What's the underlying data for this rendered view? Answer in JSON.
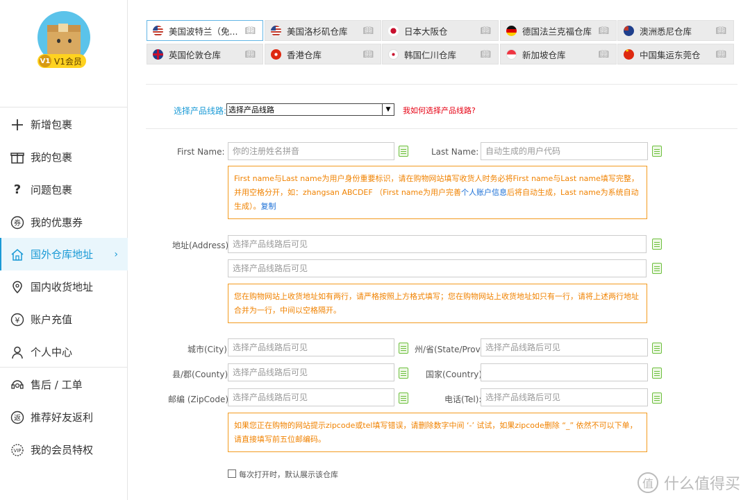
{
  "user": {
    "vip_level": "V1",
    "vip_label": "V1会员"
  },
  "sidebar": {
    "items": [
      {
        "label": "新增包裹",
        "icon": "plus-icon"
      },
      {
        "label": "我的包裹",
        "icon": "gift-box-icon"
      },
      {
        "label": "问题包裹",
        "icon": "question-icon"
      },
      {
        "label": "我的优惠券",
        "icon": "coupon-icon"
      },
      {
        "label": "国外仓库地址",
        "icon": "home-icon",
        "active": true
      },
      {
        "label": "国内收货地址",
        "icon": "location-pin-icon"
      },
      {
        "label": "账户充值",
        "icon": "yen-icon"
      },
      {
        "label": "个人中心",
        "icon": "user-icon"
      },
      {
        "label": "售后 / 工单",
        "icon": "headset-icon"
      },
      {
        "label": "推荐好友返利",
        "icon": "rebate-icon"
      },
      {
        "label": "我的会员特权",
        "icon": "vip-icon"
      }
    ],
    "active_chevron": "›"
  },
  "tabs": [
    {
      "label": "美国波特兰（免...",
      "flag": "us",
      "active": true
    },
    {
      "label": "美国洛杉矶仓库",
      "flag": "us"
    },
    {
      "label": "日本大阪仓",
      "flag": "jp"
    },
    {
      "label": "德国法兰克福仓库",
      "flag": "de"
    },
    {
      "label": "澳洲悉尼仓库",
      "flag": "au"
    },
    {
      "label": "英国伦敦仓库",
      "flag": "uk"
    },
    {
      "label": "香港仓库",
      "flag": "hk"
    },
    {
      "label": "韩国仁川仓库",
      "flag": "kr"
    },
    {
      "label": "新加坡仓库",
      "flag": "sg"
    },
    {
      "label": "中国集运东莞仓",
      "flag": "cn"
    }
  ],
  "route": {
    "label": "选择产品线路:",
    "selected": "选择产品线路",
    "help": "我如何选择产品线路?"
  },
  "form": {
    "first_name_label": "First Name:",
    "first_name_placeholder": "你的注册姓名拼音",
    "last_name_label": "Last Name:",
    "last_name_placeholder": "自动生成的用户代码",
    "name_note_part1": "First name与Last name为用户身份重要标识，请在购物网站填写收货人时务必将First name与Last name填写完整，并用空格分开，如：zhangsan ABCDEF （First name为用户完善",
    "name_note_link": "个人账户信息",
    "name_note_part2": "后将自动生成，Last name为系统自动生成）。",
    "name_note_copy": "复制",
    "address_label": "地址(Address):",
    "address1_placeholder": "选择产品线路后可见",
    "address2_placeholder": "选择产品线路后可见",
    "address_note": "您在购物网站上收货地址如有两行，请严格按照上方格式填写；您在购物网站上收货地址如只有一行，请将上述两行地址合并为一行，中间以空格隔开。",
    "city_label": "城市(City):",
    "city_placeholder": "选择产品线路后可见",
    "state_label": "州/省(State/Prov.):",
    "state_placeholder": "选择产品线路后可见",
    "county_label": "县/郡(County):",
    "county_placeholder": "选择产品线路后可见",
    "country_label": "国家(Country):",
    "country_value": "",
    "zip_label": "邮编 (ZipCode):",
    "zip_placeholder": "选择产品线路后可见",
    "tel_label": "电话(Tel):",
    "tel_placeholder": "选择产品线路后可见",
    "zip_note": "如果您正在购物的网站提示zipcode或tel填写错误，请删除数字中间 ‘-’ 试试，如果zipcode删除 “_” 依然不可以下单，请直接填写前五位邮编码。",
    "default_checkbox_label": "每次打开时，默认展示该仓库"
  },
  "watermark": {
    "text": "什么值得买",
    "logo": "值"
  },
  "colors": {
    "accent": "#1a9ad6",
    "warning": "#f08200",
    "danger": "#e60012",
    "copy_green": "#6cbf3c"
  }
}
